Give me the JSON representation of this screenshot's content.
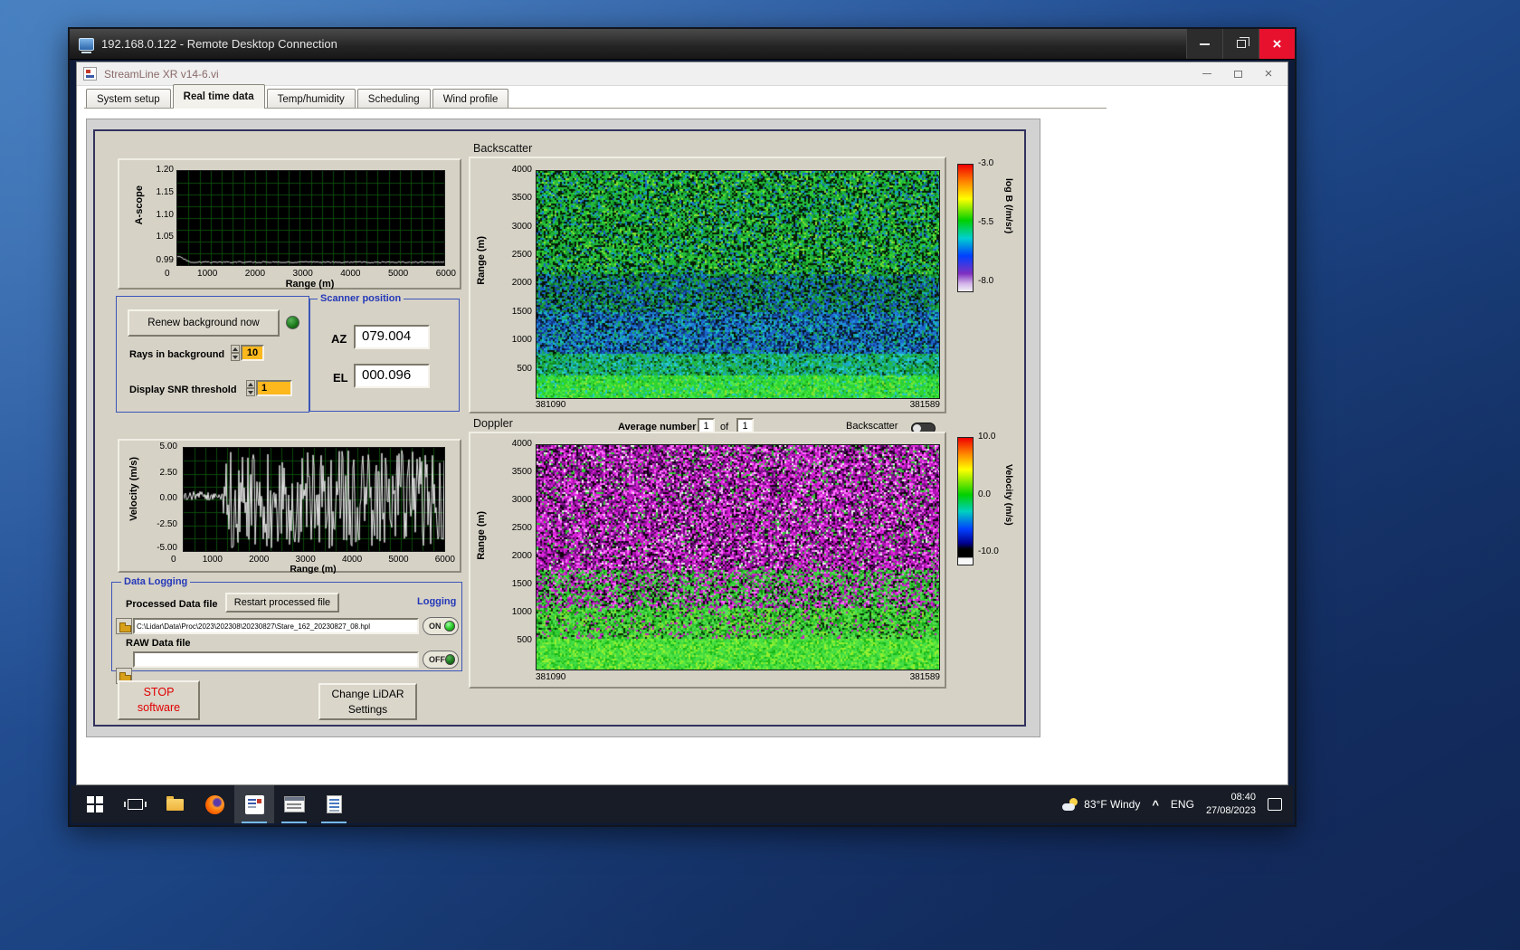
{
  "accent_colors": {
    "panel_tan": "#d6d2c6",
    "group_border_blue": "#3c55b8",
    "value_orange": "#fcb81d",
    "led_green": "#22c522",
    "stop_red": "#e00000",
    "close_red": "#e8112d"
  },
  "rdp_window": {
    "title": "192.168.0.122 - Remote Desktop Connection"
  },
  "app_window": {
    "title": "StreamLine XR v14-6.vi",
    "tabs": [
      "System setup",
      "Real time data",
      "Temp/humidity",
      "Scheduling",
      "Wind profile"
    ],
    "active_tab": "Real time data"
  },
  "background_controls": {
    "renew_button": "Renew background now",
    "rays_label": "Rays in background",
    "rays_value": "10",
    "snr_label": "Display SNR threshold",
    "snr_value": "1"
  },
  "scanner_position": {
    "title": "Scanner position",
    "az_label": "AZ",
    "az_value": "079.004",
    "el_label": "EL",
    "el_value": "000.096"
  },
  "doppler_controls": {
    "average_label": "Average number",
    "average_value": "1",
    "of_label": "of",
    "average_total": "1",
    "backscatter_toggle_label": "Backscatter"
  },
  "data_logging": {
    "group_title": "Data Logging",
    "processed_label": "Processed Data file",
    "restart_button": "Restart processed file",
    "logging_label": "Logging",
    "processed_path": "C:\\Lidar\\Data\\Proc\\2023\\202308\\20230827\\Stare_162_20230827_08.hpl",
    "processed_logging_state": "ON",
    "raw_label": "RAW Data file",
    "raw_path": "",
    "raw_logging_state": "OFF"
  },
  "action_buttons": {
    "stop_line1": "STOP",
    "stop_line2": "software",
    "change_line1": "Change LiDAR",
    "change_line2": "Settings"
  },
  "taskbar": {
    "weather": "83°F Windy",
    "hidden_icons_caret": "^",
    "language": "ENG",
    "clock_time": "08:40",
    "clock_date": "27/08/2023"
  },
  "chart_data": [
    {
      "id": "a_scope",
      "type": "line",
      "ylabel": "A-scope",
      "xlabel": "Range (m)",
      "ylim": [
        0.99,
        1.2
      ],
      "xlim": [
        0,
        6000
      ],
      "yticks": [
        "1.20",
        "1.15",
        "1.10",
        "1.05",
        "0.99"
      ],
      "xticks": [
        "0",
        "1000",
        "2000",
        "3000",
        "4000",
        "5000",
        "6000"
      ],
      "grid": "fine green grid on black",
      "series": [
        {
          "name": "amplitude",
          "summary": "flat noisy trace near 1.00 across 0-6000 m with small bump ~1.01 near 0 m"
        }
      ]
    },
    {
      "id": "velocity",
      "type": "line",
      "ylabel": "Velocity (m/s)",
      "xlabel": "Range (m)",
      "ylim": [
        -5,
        5
      ],
      "xlim": [
        0,
        6000
      ],
      "yticks": [
        "5.00",
        "2.50",
        "0.00",
        "-2.50",
        "-5.00"
      ],
      "xticks": [
        "0",
        "1000",
        "2000",
        "3000",
        "4000",
        "5000",
        "6000"
      ],
      "grid": "fine green grid on black",
      "series": [
        {
          "name": "radial velocity",
          "summary": "coherent ~0.3 m/s below ~900 m, full-scale ±5 m/s noise beyond"
        }
      ]
    },
    {
      "id": "backscatter",
      "type": "heatmap",
      "title": "Backscatter",
      "ylabel": "Range (m)",
      "ylim": [
        0,
        4000
      ],
      "yticks": [
        "4000",
        "3500",
        "3000",
        "2500",
        "2000",
        "1500",
        "1000",
        "500"
      ],
      "xticks": [
        "381090",
        "381589"
      ],
      "colorbar_label": "log B (/m/sr)",
      "colorbar_ticks": [
        "-3.0",
        "-5.5",
        "-8.0"
      ],
      "colorbar_range": [
        -3.0,
        -8.0
      ],
      "summary": "bright green (~-5.5) below ~800 m, blue band ~800-2200 m, green/black speckle noise above"
    },
    {
      "id": "doppler",
      "type": "heatmap",
      "title": "Doppler",
      "ylabel": "Range (m)",
      "ylim": [
        0,
        4000
      ],
      "yticks": [
        "4000",
        "3500",
        "3000",
        "2500",
        "2000",
        "1500",
        "1000",
        "500"
      ],
      "xticks": [
        "381090",
        "381589"
      ],
      "colorbar_label": "Velocity (m/s)",
      "colorbar_ticks": [
        "10.0",
        "0.0",
        "-10.0"
      ],
      "colorbar_range": [
        10,
        -10
      ],
      "summary": "green ~0 m/s below ~700 m, magenta/purple ±10 m/s speckle noise above"
    }
  ]
}
